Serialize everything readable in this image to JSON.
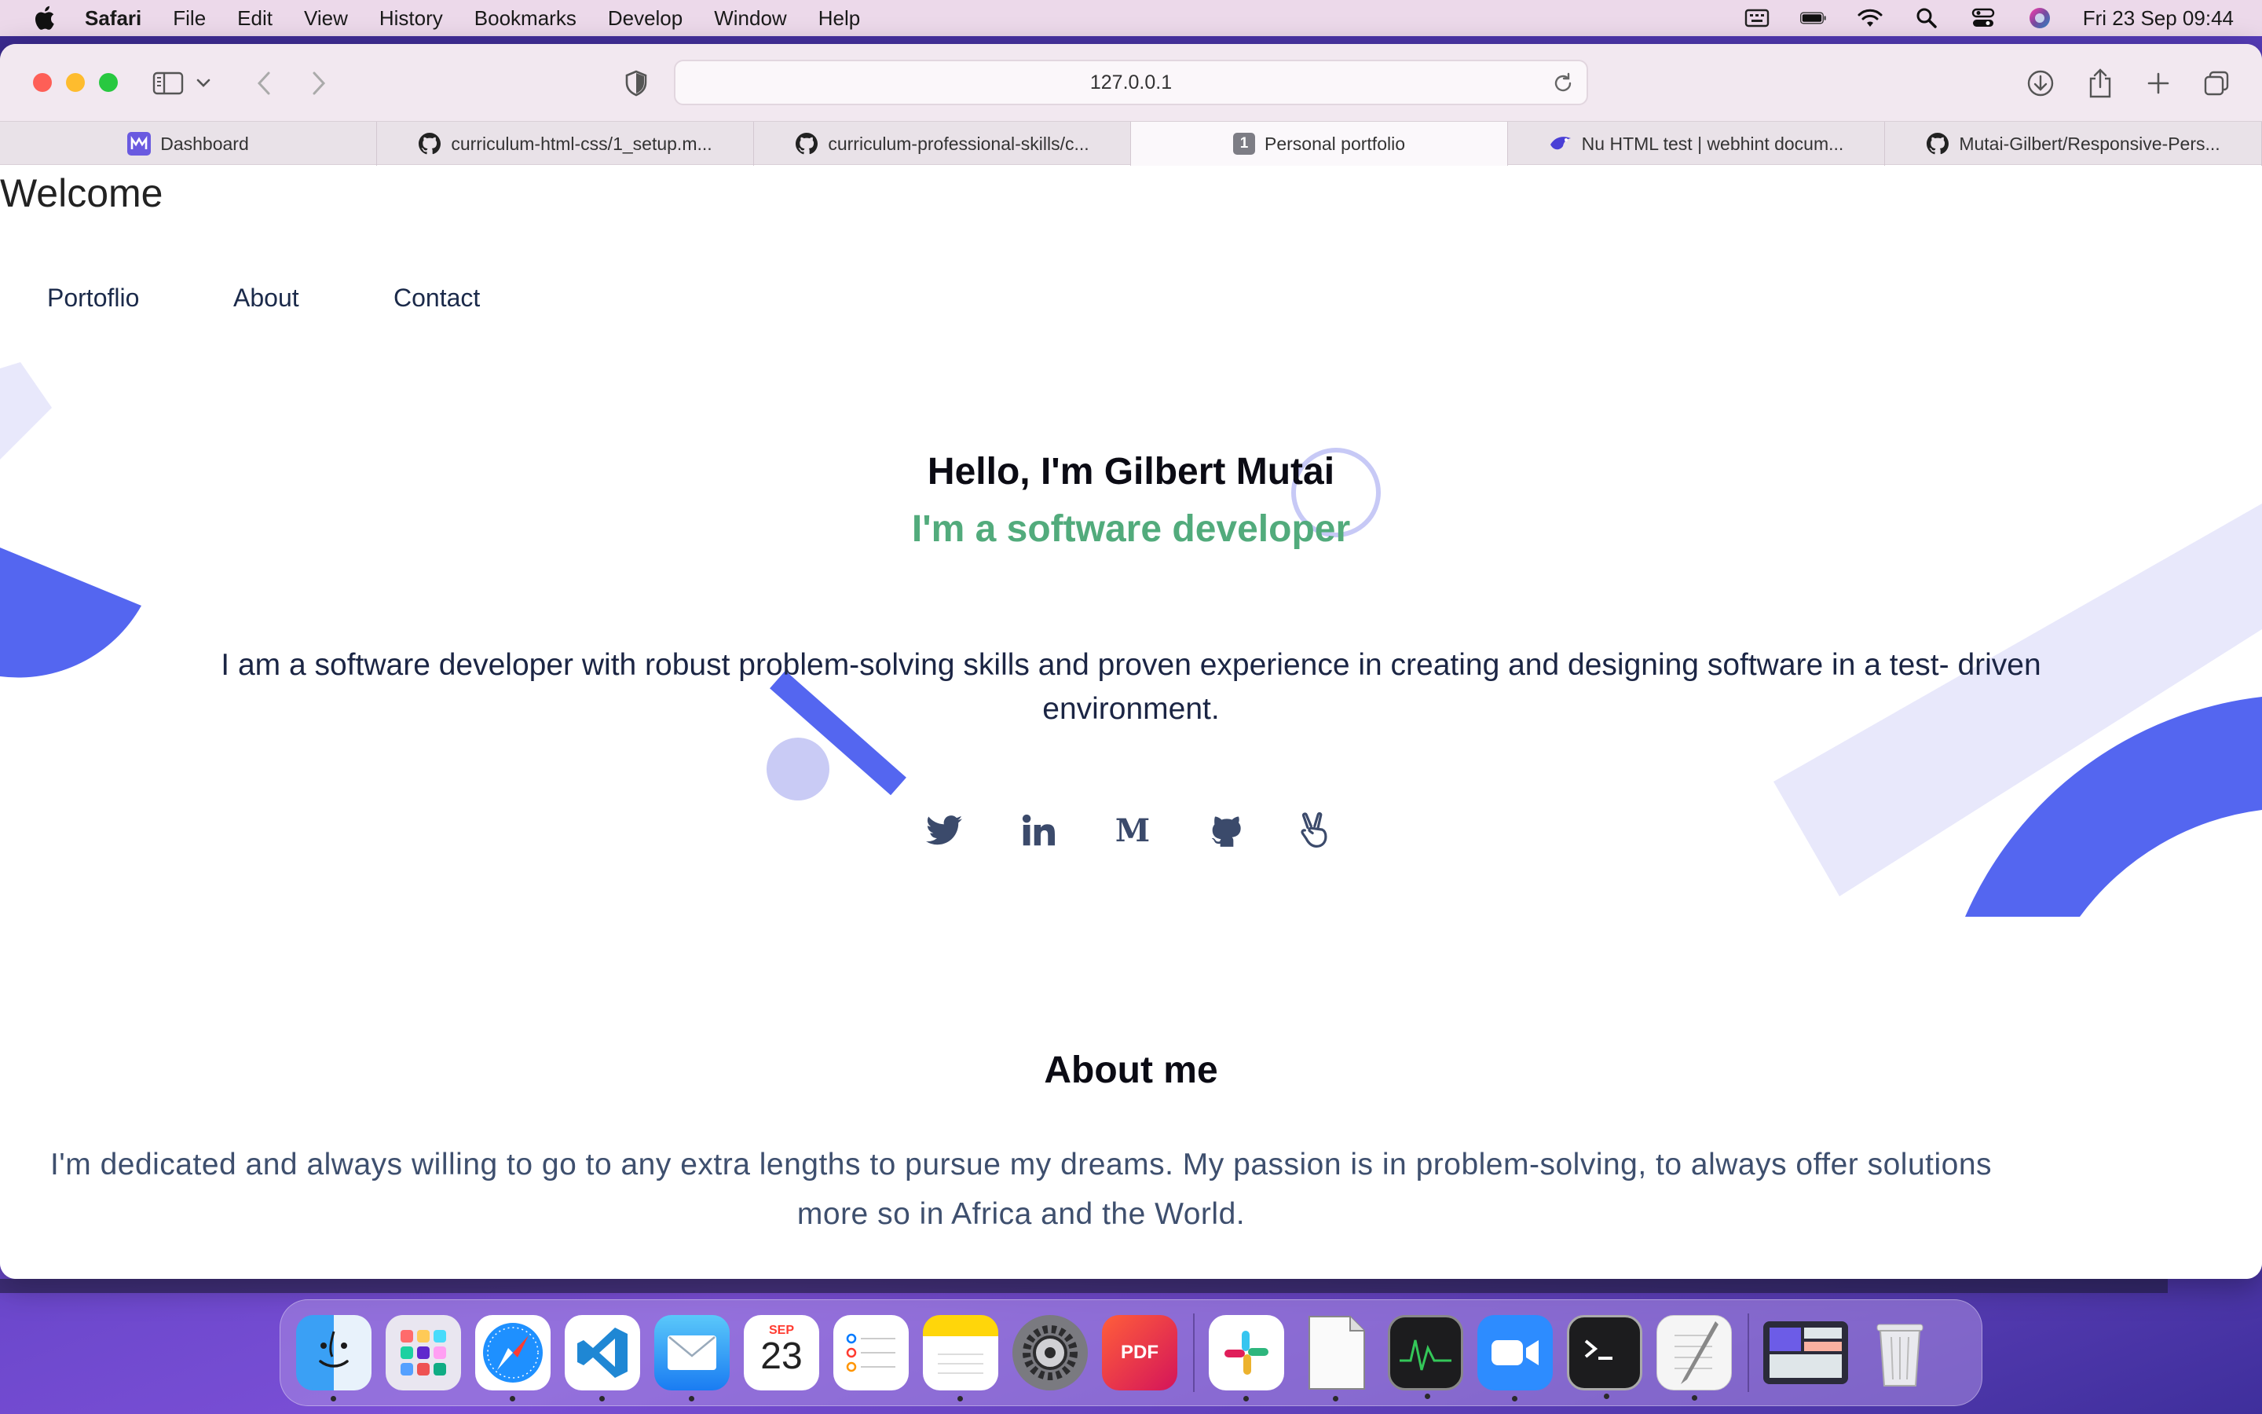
{
  "menubar": {
    "app": "Safari",
    "items": [
      "File",
      "Edit",
      "View",
      "History",
      "Bookmarks",
      "Develop",
      "Window",
      "Help"
    ],
    "clock": "Fri 23 Sep  09:44"
  },
  "browser": {
    "url": "127.0.0.1",
    "tabs": [
      {
        "label": "Dashboard",
        "icon": "dashboard-icon",
        "active": false
      },
      {
        "label": "curriculum-html-css/1_setup.m...",
        "icon": "github-icon",
        "active": false
      },
      {
        "label": "curriculum-professional-skills/c...",
        "icon": "github-icon",
        "active": false
      },
      {
        "label": "Personal portfolio",
        "icon": "tab-number-icon",
        "badge": "1",
        "active": true
      },
      {
        "label": "Nu HTML test | webhint docum...",
        "icon": "webhint-icon",
        "active": false
      },
      {
        "label": "Mutai-Gilbert/Responsive-Pers...",
        "icon": "github-icon",
        "active": false
      }
    ]
  },
  "page": {
    "welcome": "Welcome",
    "nav": [
      "Portoflio",
      "About",
      "Contact"
    ],
    "hello": "Hello, I'm Gilbert Mutai",
    "role": "I'm a software developer",
    "intro": "I am a software developer with robust problem-solving skills and proven experience in creating and designing software in a test- driven environment.",
    "socials": [
      "twitter-icon",
      "linkedin-icon",
      "medium-icon",
      "github-icon",
      "angellist-icon"
    ],
    "medium_letter": "M",
    "about_title": "About me",
    "about_text": "I'm dedicated and always willing to go to any extra lengths to pursue my dreams. My passion is in problem-solving, to always offer solutions more so in Africa and the World.",
    "colors": {
      "accent_green": "#52ab7c",
      "shape_blue": "#5466f0",
      "shape_light": "#e8e8fb"
    }
  },
  "dock": {
    "apps": [
      "Finder",
      "Launchpad",
      "Safari",
      "Visual Studio Code",
      "Mail",
      "Calendar",
      "Reminders",
      "Notes",
      "System Preferences",
      "PDF Expert",
      "Slack",
      "TextEdit",
      "Activity Monitor",
      "Zoom",
      "Terminal",
      "Script Editor",
      "Preview",
      "Trash"
    ],
    "calendar_month": "SEP",
    "calendar_day": "23",
    "pdf_label": "PDF"
  }
}
